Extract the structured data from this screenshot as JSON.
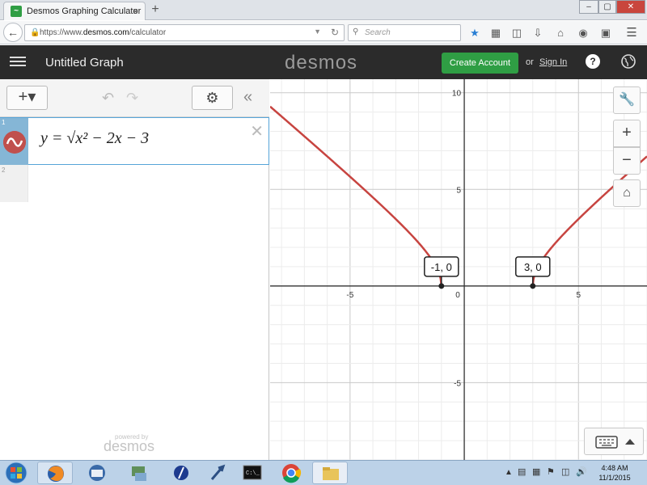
{
  "browser": {
    "tab_title": "Desmos Graphing Calculator",
    "tab_close": "×",
    "new_tab": "+",
    "url_prefix": "https://www.",
    "url_domain": "desmos.com",
    "url_path": "/calculator",
    "search_placeholder": "Search",
    "window_buttons": {
      "minimize": "–",
      "maximize": "▢",
      "close": "✕"
    }
  },
  "header": {
    "graph_title": "Untitled Graph",
    "logo_text": "desmos",
    "create_account_label": "Create Account",
    "or_text": "or",
    "sign_in_label": "Sign In",
    "help_label": "?"
  },
  "expression_panel": {
    "add_label": "+▾",
    "settings_icon": "gear-icon",
    "collapse_label": "«",
    "expressions": [
      {
        "number": "1",
        "latex_display": "y = √x² − 2x − 3",
        "color": "#c0504d",
        "close": "✕"
      },
      {
        "number": "2",
        "latex_display": ""
      }
    ],
    "powered_by": "powered by",
    "powered_logo": "desmos"
  },
  "graph": {
    "x_ticks": [
      "-5",
      "0",
      "5"
    ],
    "y_ticks": [
      "10",
      "5",
      "-5"
    ],
    "x_range": [
      -8.5,
      8.0
    ],
    "y_range": [
      -9.0,
      10.7
    ],
    "curve_color": "#c74440",
    "points": [
      {
        "x": -1,
        "y": 0,
        "label": "-1, 0"
      },
      {
        "x": 3,
        "y": 0,
        "label": "3, 0"
      }
    ]
  },
  "taskbar": {
    "time": "4:48 AM",
    "date": "11/1/2015"
  }
}
